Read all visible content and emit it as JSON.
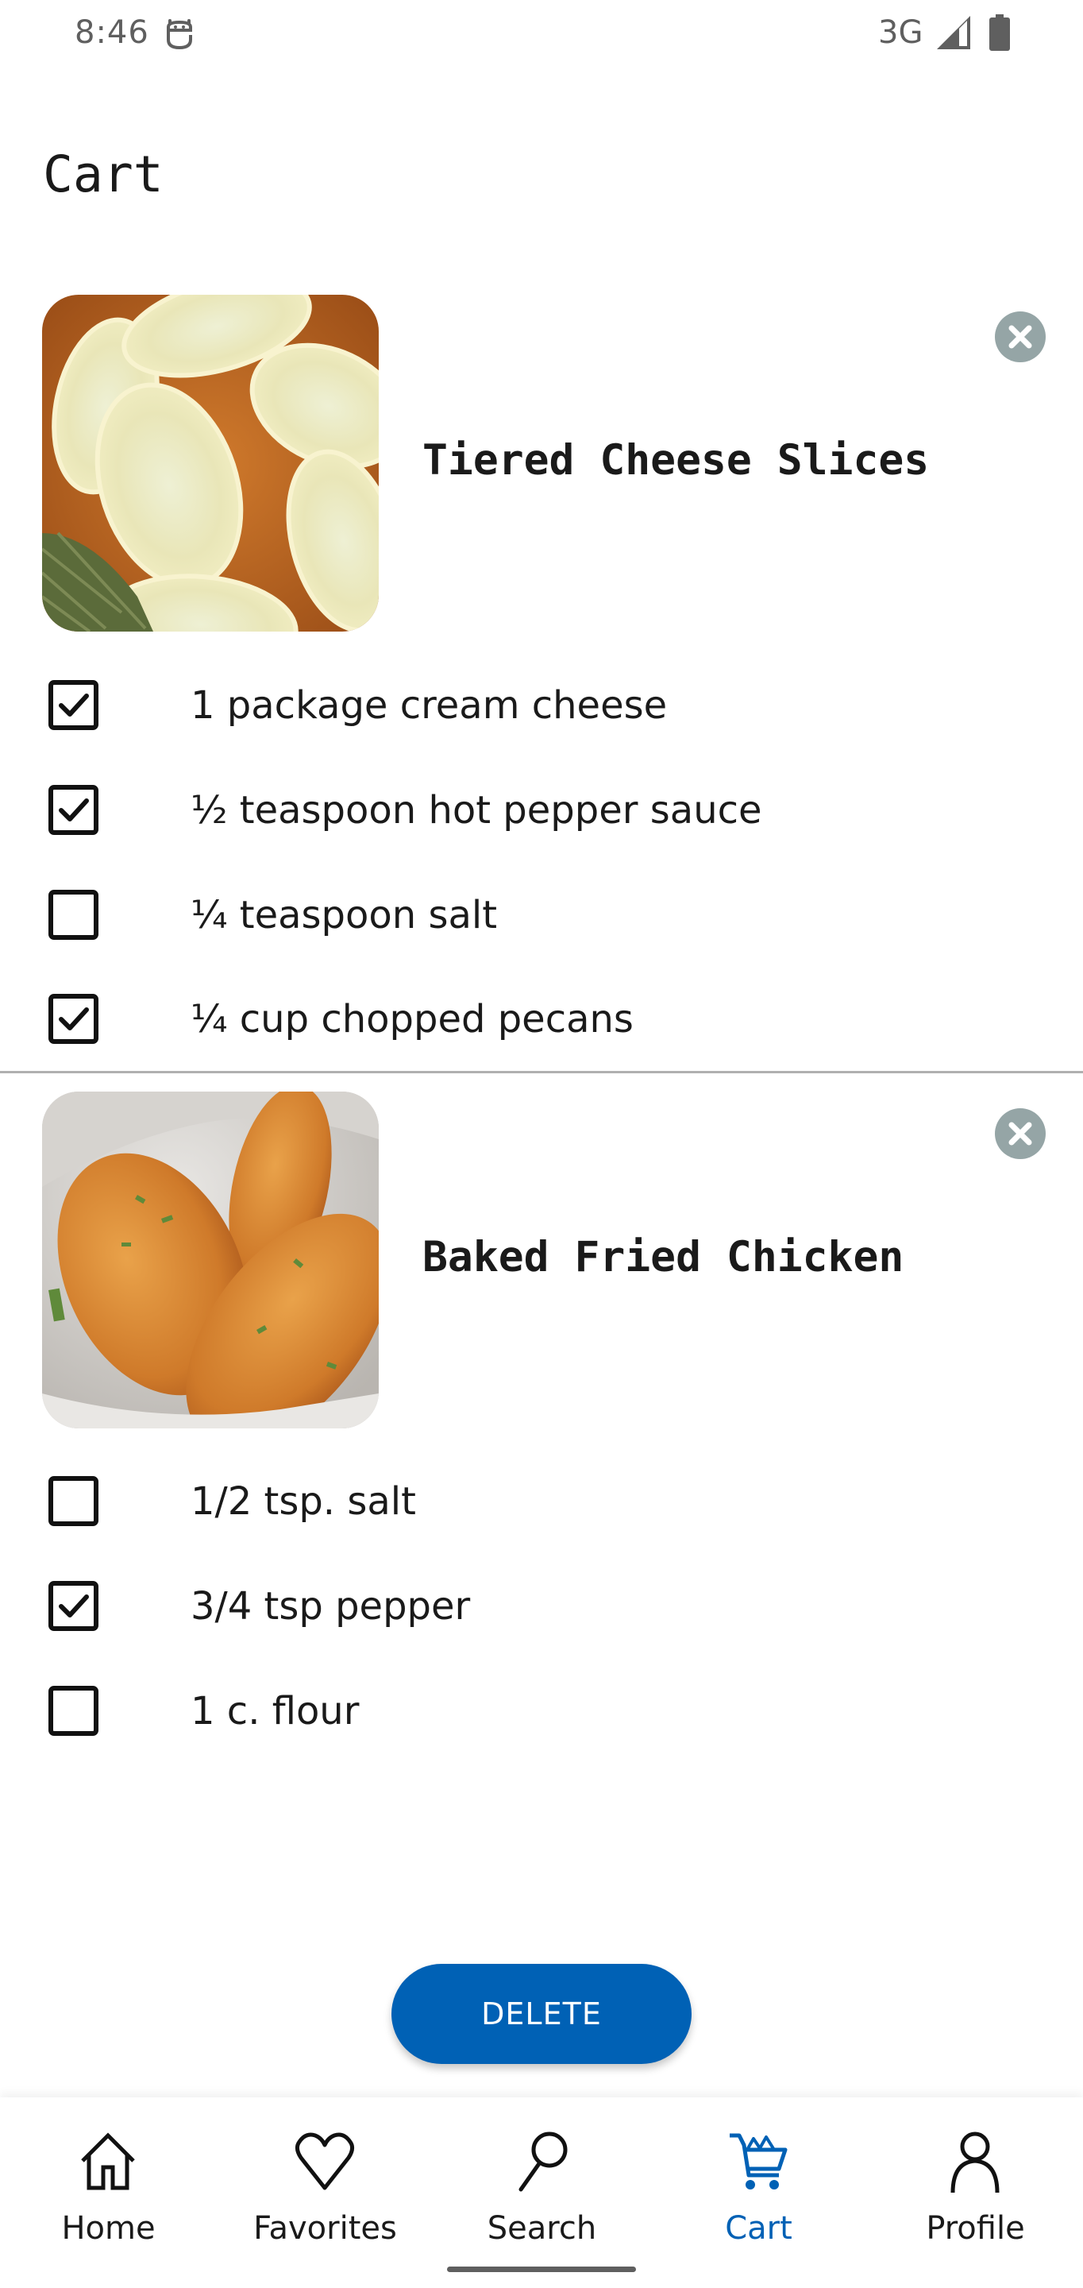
{
  "status_bar": {
    "time": "8:46",
    "notification_icon": "android-debug-icon",
    "network": "3G",
    "signal_icon": "cell-signal-icon",
    "battery_icon": "battery-full-icon"
  },
  "page": {
    "title": "Cart"
  },
  "colors": {
    "accent": "#0061b5",
    "remove_button": "#95a5a6",
    "divider": "#b0b0b0"
  },
  "recipes": [
    {
      "title": "Tiered Cheese Slices",
      "image": "cheese-pinwheel-slices-photo",
      "remove_icon": "close-circle-icon",
      "ingredients": [
        {
          "text": "1 package cream cheese",
          "checked": true
        },
        {
          "text": "½ teaspoon hot pepper sauce",
          "checked": true
        },
        {
          "text": "¼ teaspoon salt",
          "checked": false
        },
        {
          "text": "¼ cup chopped pecans",
          "checked": true
        }
      ]
    },
    {
      "title": "Baked Fried Chicken",
      "image": "fried-chicken-photo",
      "remove_icon": "close-circle-icon",
      "ingredients": [
        {
          "text": "1/2 tsp. salt",
          "checked": false
        },
        {
          "text": "3/4 tsp pepper",
          "checked": true
        },
        {
          "text": "1 c. flour",
          "checked": false
        }
      ]
    }
  ],
  "actions": {
    "delete_label": "DELETE"
  },
  "bottom_nav": {
    "active": "Cart",
    "items": [
      {
        "label": "Home",
        "icon": "home-icon"
      },
      {
        "label": "Favorites",
        "icon": "heart-icon"
      },
      {
        "label": "Search",
        "icon": "search-icon"
      },
      {
        "label": "Cart",
        "icon": "cart-icon"
      },
      {
        "label": "Profile",
        "icon": "profile-icon"
      }
    ]
  }
}
